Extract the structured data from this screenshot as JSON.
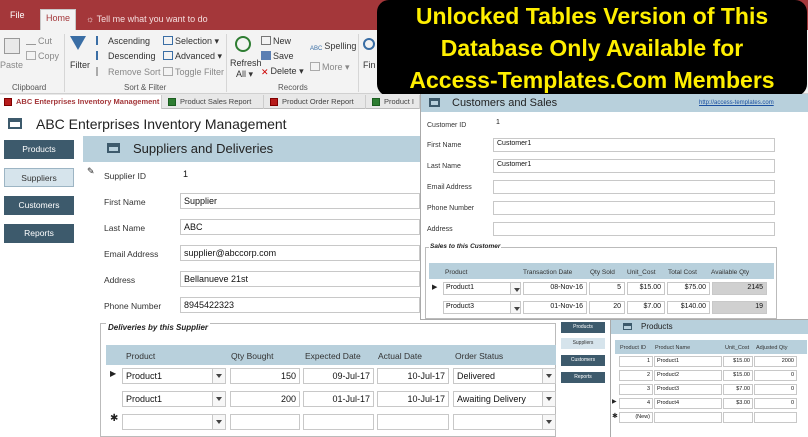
{
  "ribbon": {
    "tabs": [
      "File",
      "Home"
    ],
    "tellme": "Tell me what you want to do",
    "clipboard": {
      "paste": "Paste",
      "cut": "Cut",
      "copy": "Copy",
      "group": "Clipboard"
    },
    "sort": {
      "filter": "Filter",
      "ascending": "Ascending",
      "descending": "Descending",
      "remove_sort": "Remove Sort",
      "selection": "Selection",
      "advanced": "Advanced",
      "toggle_filter": "Toggle Filter",
      "group": "Sort & Filter"
    },
    "records": {
      "refresh": "Refresh",
      "refresh_all": "All",
      "new": "New",
      "save": "Save",
      "delete": "Delete",
      "spelling": "Spelling",
      "more": "More",
      "group": "Records"
    },
    "find": "Fin"
  },
  "banner": {
    "line1": "Unlocked Tables Version of This",
    "line2": "Database Only Available for",
    "line3": "Access-Templates.Com Members"
  },
  "doc_tabs": [
    "ABC Enterprises Inventory Management",
    "Product Sales Report",
    "Product Order Report",
    "Product I"
  ],
  "main": {
    "title": "ABC Enterprises Inventory Management",
    "nav": [
      "Products",
      "Suppliers",
      "Customers",
      "Reports"
    ],
    "subtitle": "Suppliers and Deliveries",
    "fields": [
      {
        "label": "Supplier ID",
        "value": "1"
      },
      {
        "label": "First Name",
        "value": "Supplier"
      },
      {
        "label": "Last Name",
        "value": "ABC"
      },
      {
        "label": "Email Address",
        "value": "supplier@abccorp.com"
      },
      {
        "label": "Address",
        "value": "Bellanueve 21st"
      },
      {
        "label": "Phone Number",
        "value": "8945422323"
      }
    ],
    "deliveries": {
      "title": "Deliveries by this Supplier",
      "headers": [
        "Product",
        "Qty Bought",
        "Expected Date",
        "Actual Date",
        "Order Status"
      ],
      "rows": [
        [
          "Product1",
          "150",
          "09-Jul-17",
          "10-Jul-17",
          "Delivered"
        ],
        [
          "Product1",
          "200",
          "01-Jul-17",
          "10-Jul-17",
          "Awaiting Delivery"
        ]
      ]
    }
  },
  "customers": {
    "title": "Customers and Sales",
    "link": "http://access-templates.com",
    "fields": [
      {
        "label": "Customer ID",
        "value": "1"
      },
      {
        "label": "First Name",
        "value": "Customer1"
      },
      {
        "label": "Last Name",
        "value": "Customer1"
      },
      {
        "label": "Email Address",
        "value": ""
      },
      {
        "label": "Phone Number",
        "value": ""
      },
      {
        "label": "Address",
        "value": ""
      }
    ],
    "sales": {
      "title": "Sales to this Customer",
      "headers": [
        "Product",
        "Transaction Date",
        "Qty Sold",
        "Unit_Cost",
        "Total Cost",
        "Available Qty"
      ],
      "rows": [
        [
          "Product1",
          "08-Nov-16",
          "5",
          "$15.00",
          "$75.00",
          "2145"
        ],
        [
          "Product3",
          "01-Nov-16",
          "20",
          "$7.00",
          "$140.00",
          "19"
        ]
      ]
    }
  },
  "mini_nav": [
    "Products",
    "Suppliers",
    "Customers",
    "Reports"
  ],
  "products": {
    "title": "Products",
    "headers": [
      "Product ID",
      "Product Name",
      "Unit_Cost",
      "Adjusted Qty"
    ],
    "rows": [
      [
        "1",
        "Product1",
        "$15.00",
        "2000"
      ],
      [
        "2",
        "Product2",
        "$15.00",
        "0"
      ],
      [
        "3",
        "Product3",
        "$7.00",
        "0"
      ],
      [
        "4",
        "Product4",
        "$3.00",
        "0"
      ]
    ],
    "new_label": "(New)"
  },
  "colors": {
    "ribbon": "#a4373a",
    "nav": "#3d5a6c",
    "header": "#b8d0dc",
    "banner_text": "#ffef00"
  }
}
